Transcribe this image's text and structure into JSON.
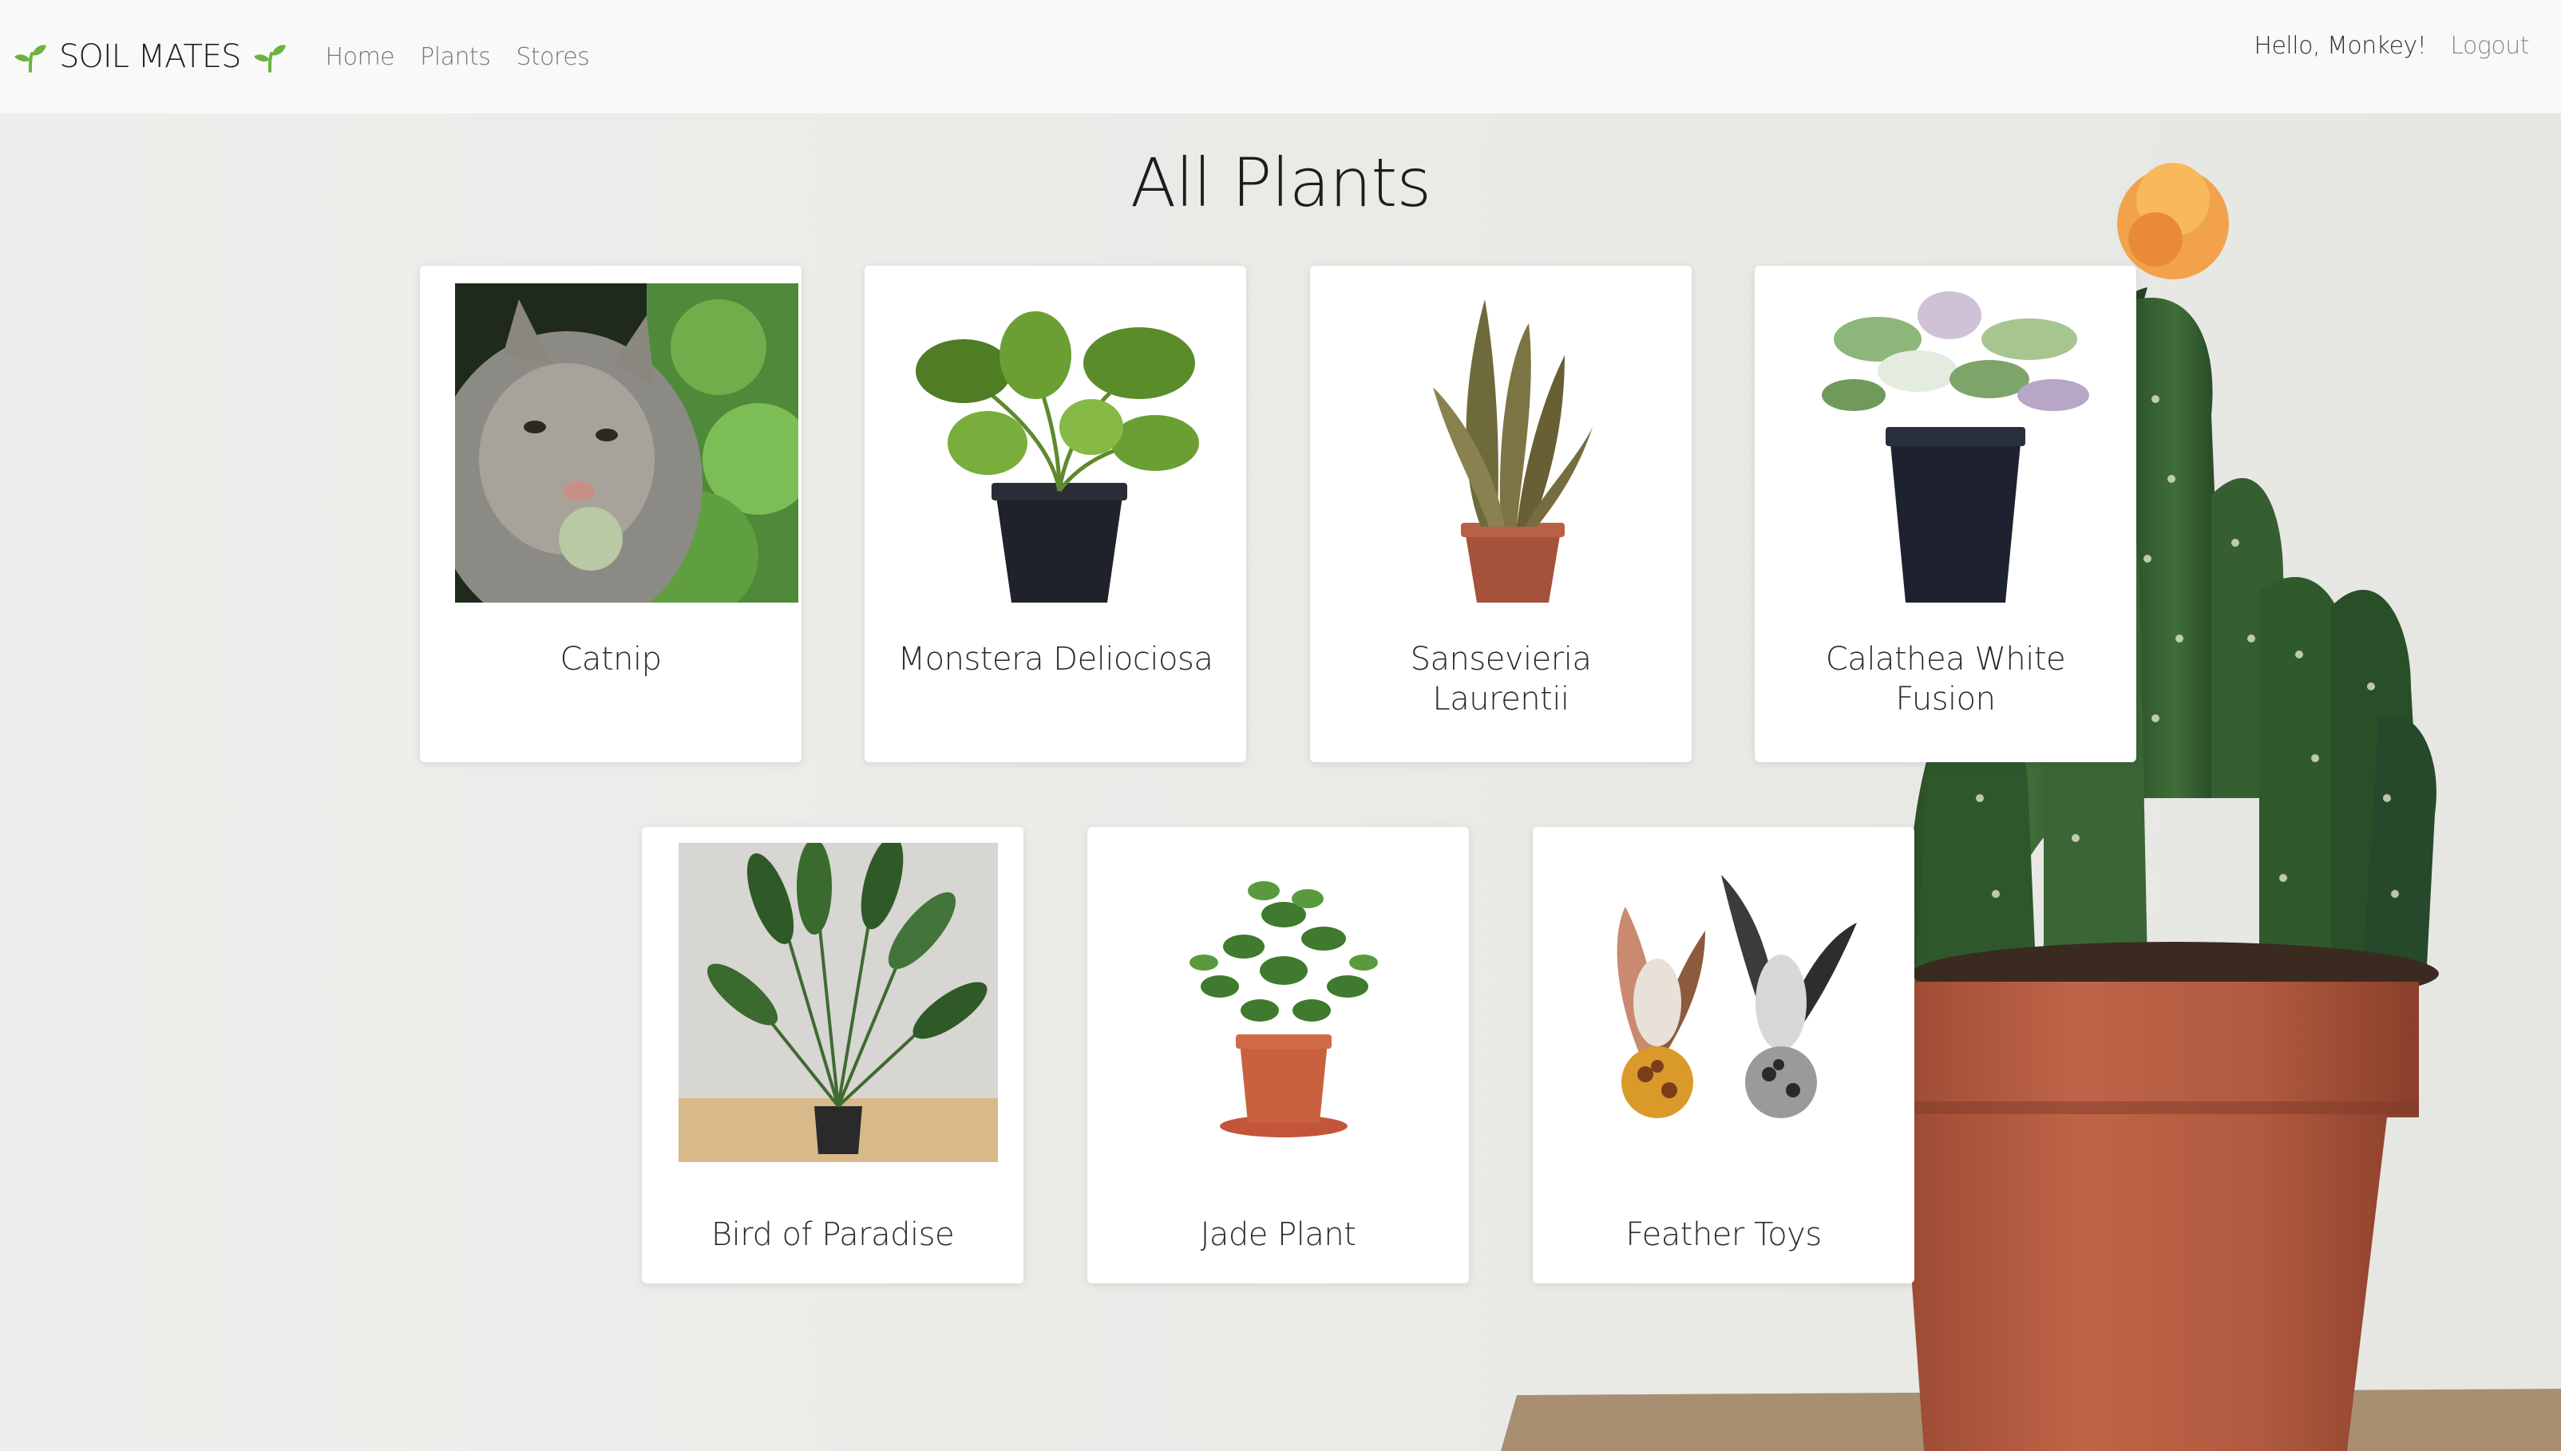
{
  "navbar": {
    "brand": "SOIL MATES",
    "links": [
      "Home",
      "Plants",
      "Stores"
    ],
    "greeting": "Hello, Monkey!",
    "logout": "Logout"
  },
  "page": {
    "title": "All Plants"
  },
  "plants": [
    {
      "name": "Catnip",
      "image": "cat-eating-catnip"
    },
    {
      "name": "Monstera Deliociosa",
      "image": "monstera-in-black-pot"
    },
    {
      "name": "Sansevieria Laurentii",
      "image": "snake-plant-in-terracotta-pot"
    },
    {
      "name": "Calathea White Fusion",
      "image": "calathea-in-black-pot"
    },
    {
      "name": "Bird of Paradise",
      "image": "bird-of-paradise-plant"
    },
    {
      "name": "Jade Plant",
      "image": "jade-plant-in-terracotta-pot"
    },
    {
      "name": "Feather Toys",
      "image": "feather-cat-toys"
    }
  ],
  "colors": {
    "navbar_bg": "#f9f9f9",
    "page_bg": "#ebebe8",
    "sprout": "#6cb33f",
    "terracotta": "#b5573a",
    "cactus": "#2f5a2c"
  },
  "icons": {
    "brand_left": "sprout-icon",
    "brand_right": "sprout-icon"
  }
}
